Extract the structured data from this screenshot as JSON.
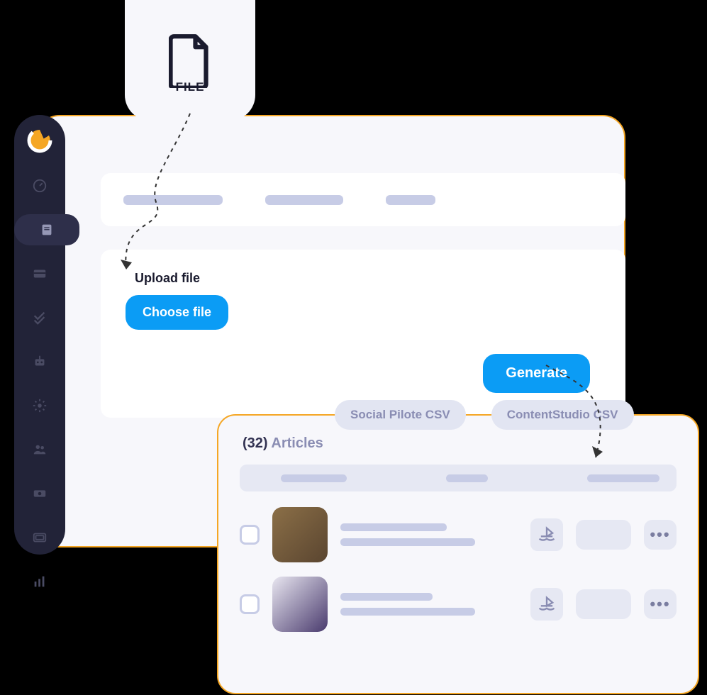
{
  "file_badge": {
    "label": "FILE"
  },
  "section": {
    "title": "Upload file",
    "choose_label": "Choose file",
    "generate_label": "Generate"
  },
  "tags": {
    "t1": "Social Pilote CSV",
    "t2": "ContentStudio CSV"
  },
  "articles": {
    "count": "(32)",
    "label": "Articles"
  },
  "sidebar_icons": [
    "dashboard",
    "book",
    "card",
    "check",
    "robot",
    "gear",
    "users",
    "money",
    "media",
    "chart"
  ]
}
